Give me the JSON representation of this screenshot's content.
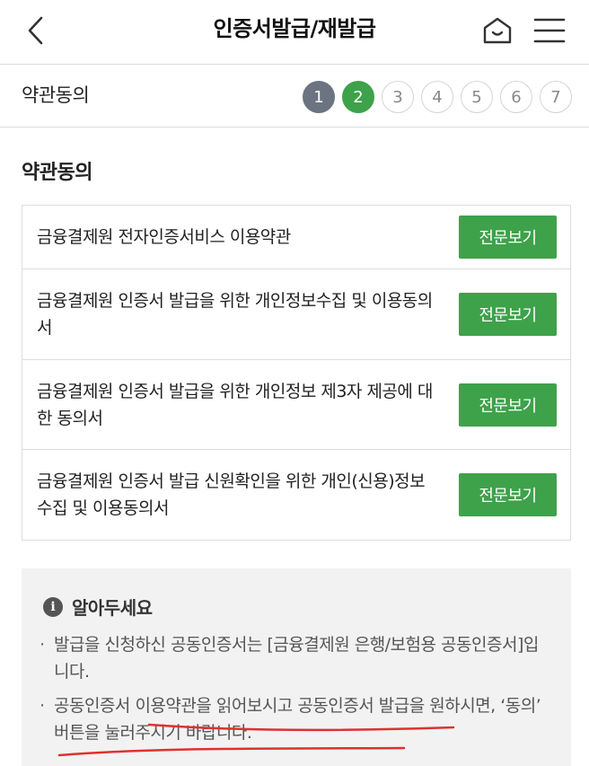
{
  "header": {
    "title": "인증서발급/재발급",
    "back_icon": "chevron-left-icon",
    "home_icon": "home-icon",
    "menu_icon": "hamburger-menu-icon"
  },
  "stepbar": {
    "title": "약관동의",
    "steps": [
      "1",
      "2",
      "3",
      "4",
      "5",
      "6",
      "7"
    ],
    "completed_step": "1",
    "current_step": "2"
  },
  "terms_section": {
    "title": "약관동의",
    "button_label": "전문보기",
    "items": [
      {
        "text": "금융결제원 전자인증서비스 이용약관"
      },
      {
        "text": "금융결제원 인증서 발급을 위한 개인정보수집 및 이용동의서"
      },
      {
        "text": "금융결제원 인증서 발급을 위한 개인정보 제3자 제공에 대한 동의서"
      },
      {
        "text": "금융결제원 인증서 발급 신원확인을 위한 개인(신용)정보 수집 및 이용동의서"
      }
    ]
  },
  "notice": {
    "title": "알아두세요",
    "items": [
      "발급을 신청하신 공동인증서는 [금융결제원 은행/보험용 공동인증서]입니다.",
      "공동인증서 이용약관을 읽어보시고 공동인증서 발급을 원하시면, ‘동의’ 버튼을 눌러주시기 바랍니다."
    ]
  },
  "colors": {
    "accent": "#3ea24a",
    "completed_step": "#6b7480",
    "notice_bg": "#f2f2f2",
    "annotation": "#e03030"
  }
}
